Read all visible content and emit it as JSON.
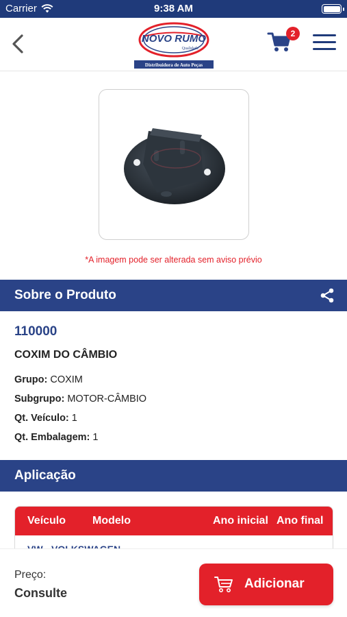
{
  "status_bar": {
    "carrier": "Carrier",
    "time": "9:38 AM"
  },
  "header": {
    "logo_title": "NOVO RUMO",
    "logo_subtitle": "Qualidade",
    "logo_tagline": "Distribuidora de Auto Peças",
    "cart_count": "2",
    "icons": {
      "back": "chevron-left-icon",
      "cart": "cart-icon",
      "menu": "hamburger-menu-icon"
    }
  },
  "product_image": {
    "disclaimer": "*A imagem pode ser alterada sem aviso prévio"
  },
  "about": {
    "title": "Sobre o Produto",
    "code": "110000",
    "name": "COXIM DO CÂMBIO",
    "specs": [
      {
        "label": "Grupo:",
        "value": "COXIM"
      },
      {
        "label": "Subgrupo:",
        "value": "MOTOR-CÂMBIO"
      },
      {
        "label": "Qt. Veículo:",
        "value": "1"
      },
      {
        "label": "Qt. Embalagem:",
        "value": "1"
      }
    ]
  },
  "application": {
    "title": "Aplicação",
    "columns": [
      "Veículo",
      "Modelo",
      "Ano inicial",
      "Ano final"
    ],
    "first_row_vehicle": "VW - VOLKSWAGEN"
  },
  "footer": {
    "price_label": "Preço:",
    "price_value": "Consulte",
    "add_label": "Adicionar"
  },
  "colors": {
    "navy": "#2a4387",
    "status_navy": "#1f3a7a",
    "red": "#e3212a"
  }
}
